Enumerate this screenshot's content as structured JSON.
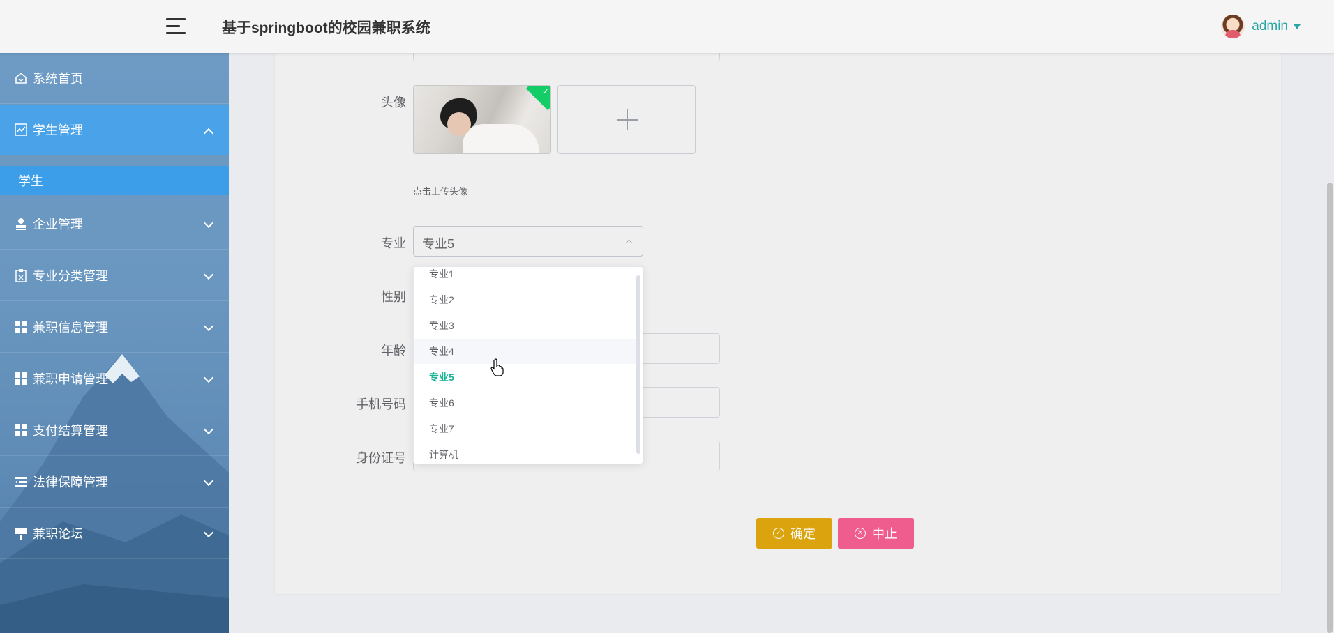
{
  "header": {
    "title": "基于springboot的校园兼职系统",
    "user": "admin"
  },
  "sidebar": {
    "items": [
      {
        "label": "系统首页",
        "icon": "home-icon"
      },
      {
        "label": "学生管理",
        "icon": "chart-icon",
        "expanded": true
      },
      {
        "label": "企业管理",
        "icon": "person-icon"
      },
      {
        "label": "专业分类管理",
        "icon": "clipboard-icon"
      },
      {
        "label": "兼职信息管理",
        "icon": "grid-icon"
      },
      {
        "label": "兼职申请管理",
        "icon": "grid-icon"
      },
      {
        "label": "支付结算管理",
        "icon": "grid-icon"
      },
      {
        "label": "法律保障管理",
        "icon": "list-icon"
      },
      {
        "label": "兼职论坛",
        "icon": "brush-icon"
      }
    ],
    "submenu": {
      "label": "学生"
    }
  },
  "form": {
    "avatar_label": "头像",
    "upload_tip": "点击上传头像",
    "major_label": "专业",
    "major_value": "专业5",
    "gender_label": "性别",
    "age_label": "年龄",
    "phone_label": "手机号码",
    "id_label": "身份证号",
    "major_options": [
      "专业1",
      "专业2",
      "专业3",
      "专业4",
      "专业5",
      "专业6",
      "专业7",
      "计算机"
    ],
    "major_hovered": "专业4",
    "major_selected": "专业5"
  },
  "buttons": {
    "ok": "确定",
    "cancel": "中止"
  },
  "colors": {
    "sidebar_active": "#4aa3e8",
    "accent": "#2aa5a5",
    "ok_button": "#dba30d",
    "cancel_button": "#ef5d8e",
    "selected_option": "#19b395"
  }
}
